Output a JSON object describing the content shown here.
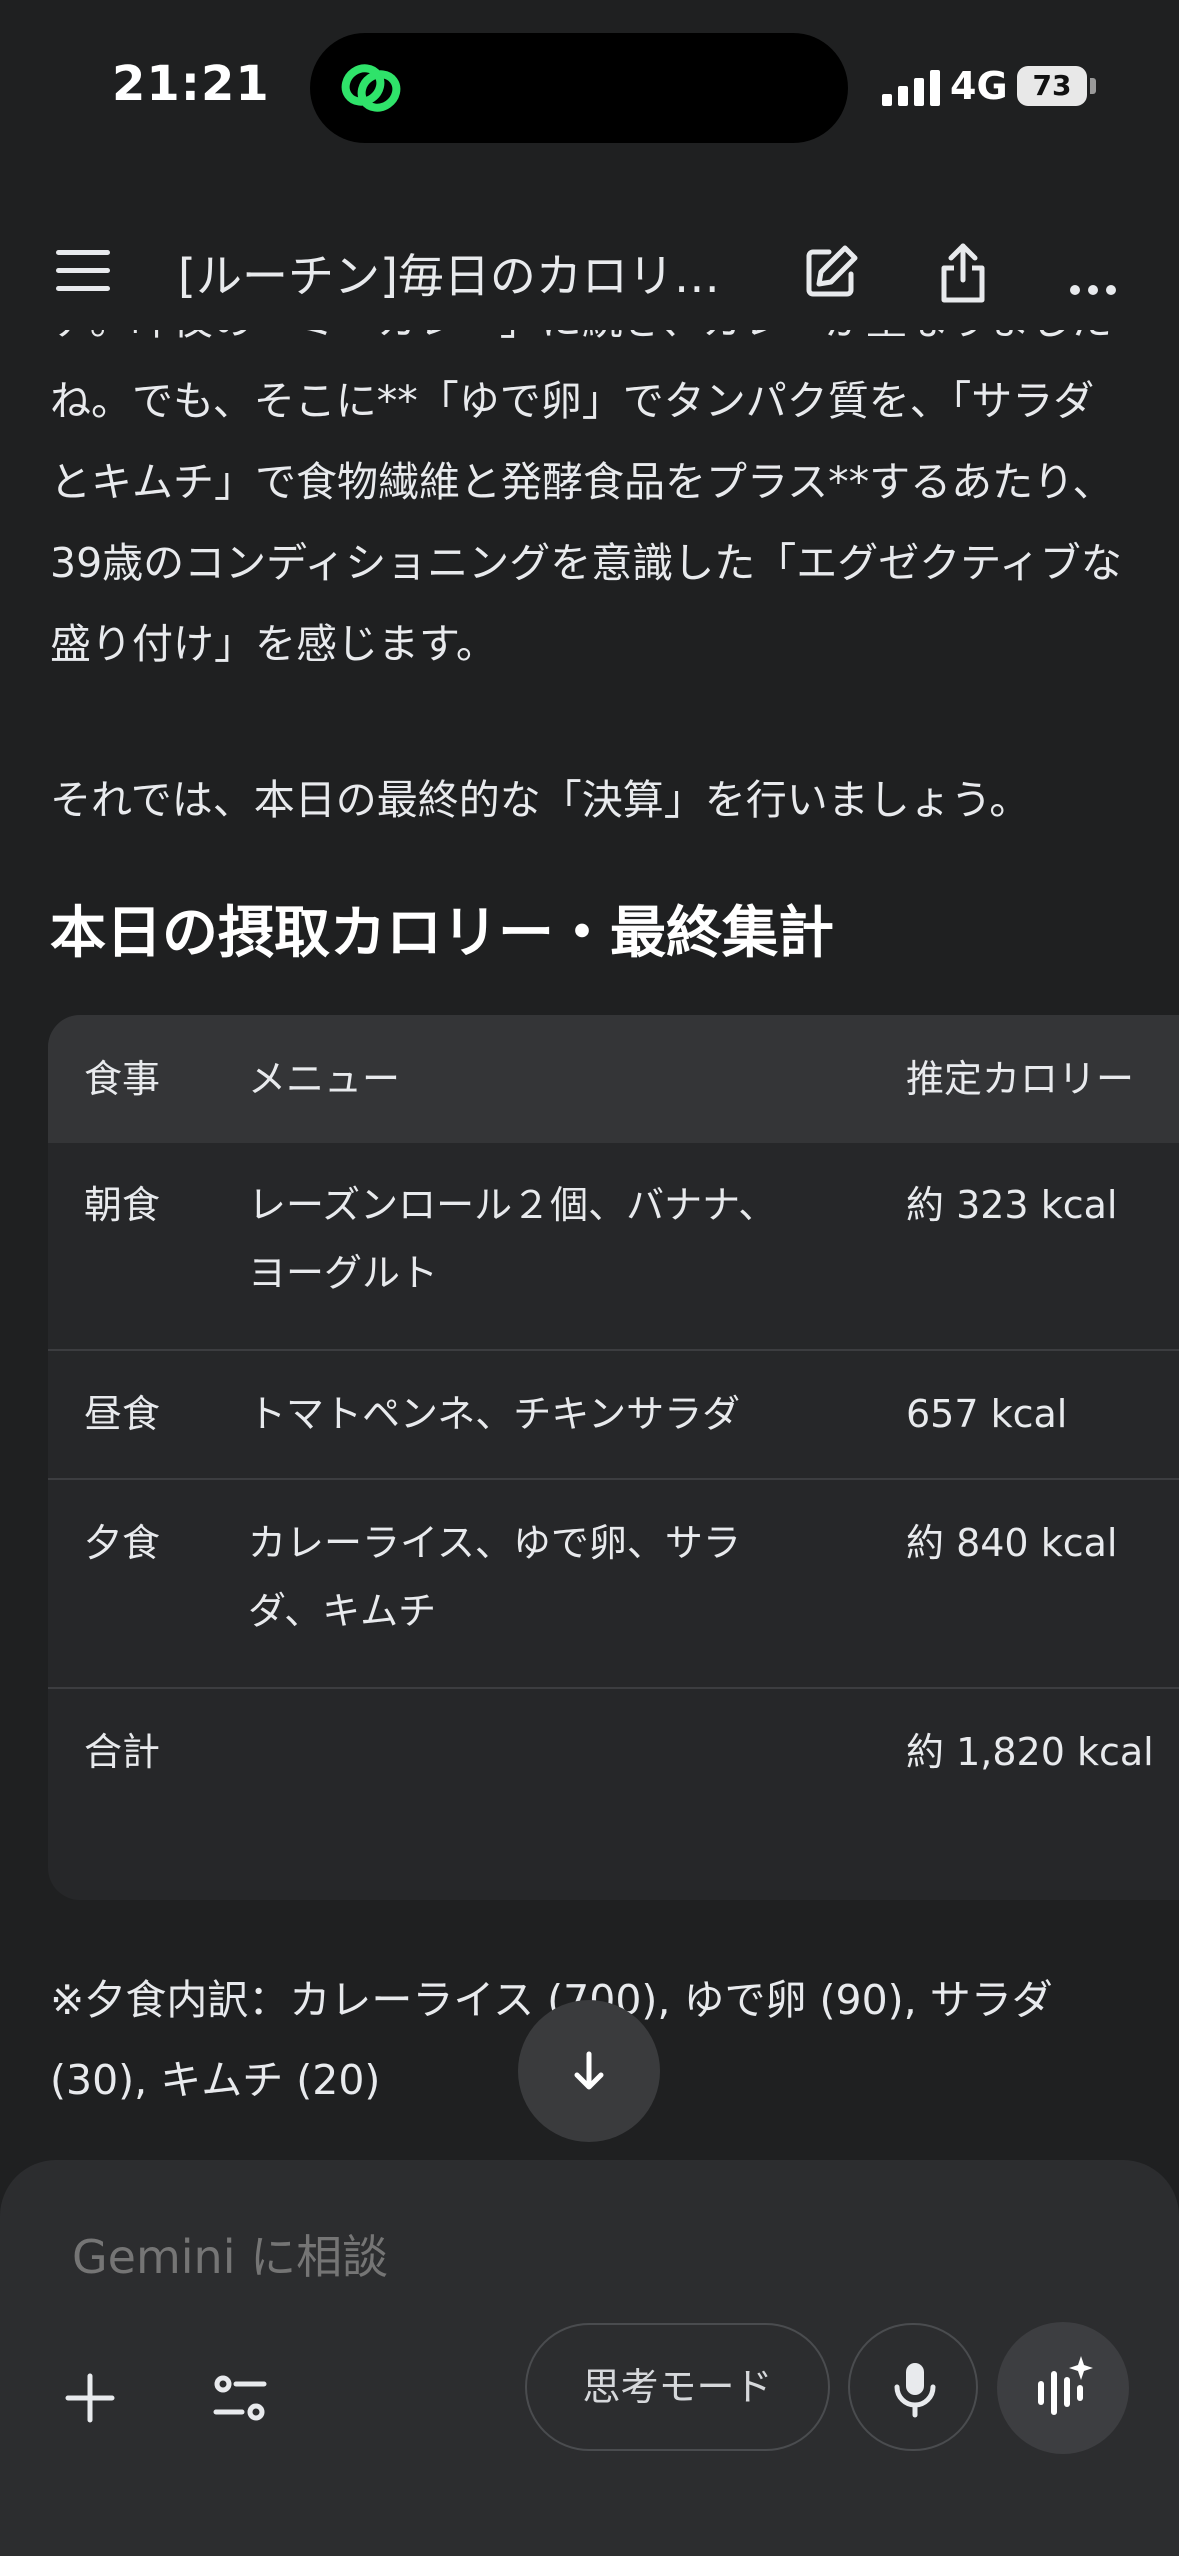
{
  "status_bar": {
    "time": "21:21",
    "network": "4G",
    "battery": "73"
  },
  "app_bar": {
    "title": "[ルーチン]毎日のカロリ…"
  },
  "message": {
    "paragraph_1": "デ。昨夜の「ミーカレー」に続き、カレーが重なりましたね。でも、そこに**「ゆで卵」でタンパク質を、「サラダとキムチ」で食物繊維と発酵食品をプラス**するあたり、39歳のコンディショニングを意識した「エグゼクティブな盛り付け」を感じます。",
    "paragraph_2": "それでは、本日の最終的な「決算」を行いましょう。",
    "heading": "本日の摂取カロリー・最終集計",
    "table": {
      "headers": [
        "食事",
        "メニュー",
        "推定カロリー"
      ],
      "rows": [
        {
          "meal": "朝食",
          "menu_line1": "レーズンロール２個、バナナ、",
          "menu_line2": "ヨーグルト",
          "kcal": "約 323 kcal"
        },
        {
          "meal": "昼食",
          "menu_line1": "トマトペンネ、チキンサラダ",
          "menu_line2": "",
          "kcal": "657 kcal"
        },
        {
          "meal": "夕食",
          "menu_line1": "カレーライス、ゆで卵、サラ",
          "menu_line2": "ダ、キムチ",
          "kcal": "約 840 kcal"
        },
        {
          "meal": "合計",
          "menu_line1": "",
          "menu_line2": "",
          "kcal": "約 1,820 kcal"
        }
      ]
    },
    "footnote": "※夕食内訳：カレーライス (700), ゆで卵 (90), サラダ (30), キムチ (20)"
  },
  "input": {
    "placeholder": "Gemini に相談",
    "thinking_mode_label": "思考モード"
  },
  "icons": {
    "menu": "menu-icon",
    "edit": "edit-icon",
    "share": "share-icon",
    "more": "more-icon",
    "scroll": "arrow-down-icon",
    "add": "plus-icon",
    "tools": "tools-icon",
    "mic": "mic-icon",
    "live": "live-icon"
  },
  "colors": {
    "background": "#1f2021",
    "panel": "#2c2d2f",
    "table_header": "#343537",
    "island_accent": "#2fe36a"
  }
}
